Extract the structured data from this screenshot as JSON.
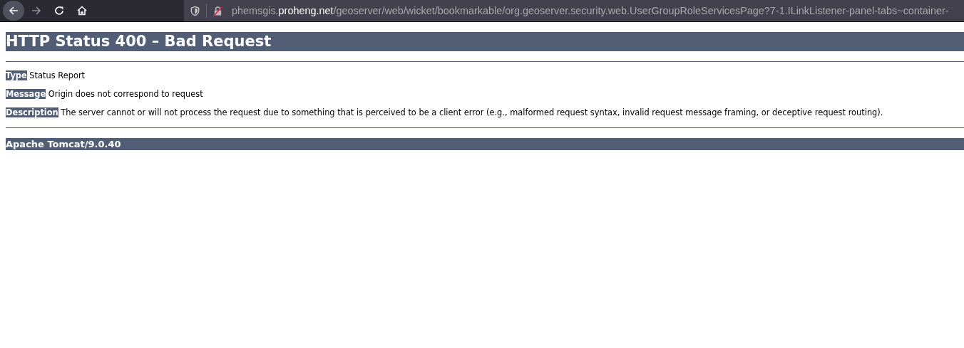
{
  "toolbar": {
    "back": {
      "disabled": false
    },
    "forward": {
      "disabled": true
    },
    "url": {
      "subdomain": "phemsgis.",
      "domain": "proheng.net",
      "path": "/geoserver/web/wicket/bookmarkable/org.geoserver.security.web.UserGroupRoleServicesPage?7-1.ILinkListener-panel-tabs~container-"
    }
  },
  "page": {
    "title": "HTTP Status 400 – Bad Request",
    "fields": [
      {
        "label": "Type",
        "value": "Status Report"
      },
      {
        "label": "Message",
        "value": "Origin does not correspond to request"
      },
      {
        "label": "Description",
        "value": "The server cannot or will not process the request due to something that is perceived to be a client error (e.g., malformed request syntax, invalid request message framing, or deceptive request routing)."
      }
    ],
    "footer": "Apache Tomcat/9.0.40"
  }
}
